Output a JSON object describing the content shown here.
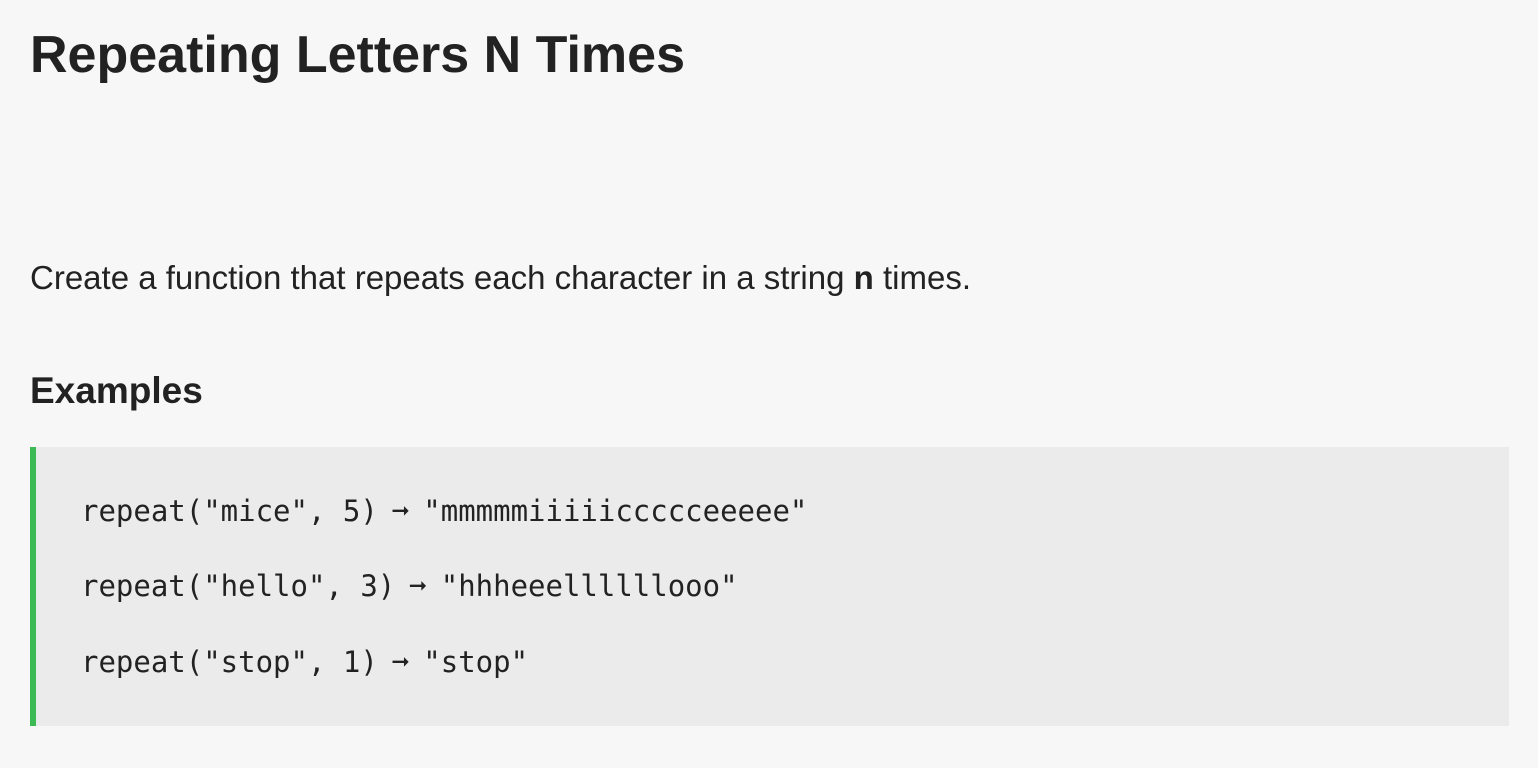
{
  "page": {
    "title": "Repeating Letters N Times"
  },
  "description": {
    "before": "Create a function that repeats each character in a string ",
    "emphasis": "n",
    "after": " times."
  },
  "examples": {
    "heading": "Examples",
    "arrow_glyph": "➞",
    "items": [
      {
        "call": "repeat(\"mice\", 5)",
        "result": "\"mmmmmiiiiiccccceeeee\""
      },
      {
        "call": "repeat(\"hello\", 3)",
        "result": "\"hhheeellllllooo\""
      },
      {
        "call": "repeat(\"stop\", 1)",
        "result": "\"stop\""
      }
    ]
  },
  "colors": {
    "background": "#f7f7f7",
    "code_background": "#ebebeb",
    "accent_border": "#3cba54",
    "text": "#222222"
  }
}
